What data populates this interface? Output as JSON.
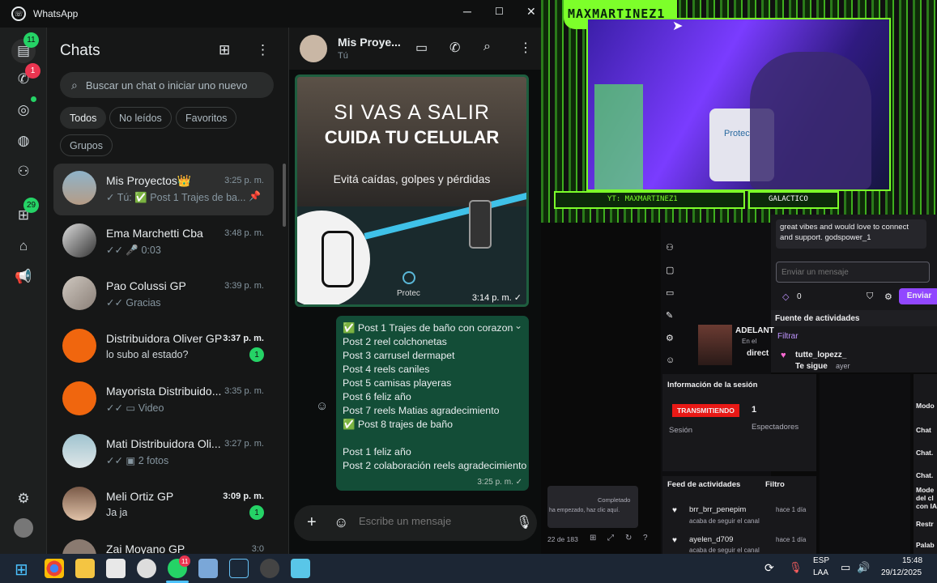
{
  "window": {
    "title": "WhatsApp",
    "minimize": "─",
    "maximize": "☐",
    "close": "✕"
  },
  "rail": {
    "chats_badge": "11",
    "calls_badge": "1",
    "archive_badge": "29"
  },
  "chatlist": {
    "title": "Chats",
    "search_placeholder": "Buscar un chat o iniciar uno nuevo",
    "filters": [
      "Todos",
      "No leídos",
      "Favoritos",
      "Grupos"
    ],
    "items": [
      {
        "name": "Mis Proyectos👑",
        "time": "3:25 p. m.",
        "preview": "✓ Tú: ✅ Post 1 Trajes de ba...",
        "pinned": true
      },
      {
        "name": "Ema Marchetti Cba",
        "time": "3:48 p. m.",
        "preview": "✓✓ 🎤 0:03"
      },
      {
        "name": "Pao Colussi GP",
        "time": "3:39 p. m.",
        "preview": "✓✓ Gracias"
      },
      {
        "name": "Distribuidora Oliver GP",
        "time": "3:37 p. m.",
        "preview": "lo subo al estado?",
        "unread": "1"
      },
      {
        "name": "Mayorista Distribuido...",
        "time": "3:35 p. m.",
        "preview": "✓✓ ▭ Video"
      },
      {
        "name": "Mati Distribuidora Oli...",
        "time": "3:27 p. m.",
        "preview": "✓✓ ▣ 2 fotos"
      },
      {
        "name": "Meli Ortiz GP",
        "time": "3:09 p. m.",
        "preview": "Ja ja",
        "unread": "1"
      },
      {
        "name": "Zai Moyano GP",
        "time": "3:0",
        "preview": ""
      }
    ]
  },
  "conversation": {
    "name": "Mis Proye...",
    "status": "Tú",
    "image_msg": {
      "line1": "SI VAS A SALIR",
      "line2": "CUIDA TU CELULAR",
      "line3": "Evitá caídas, golpes y pérdidas",
      "brand": "Protec",
      "time": "3:14 p. m. ✓"
    },
    "text_msg": {
      "lines": [
        "✅ Post 1 Trajes de baño con corazon",
        "Post 2 reel colchonetas",
        "Post 3 carrusel dermapet",
        "Post 4 reels caniles",
        "Post 5 camisas playeras",
        "Post 6 feliz año",
        "Post 7 reels Matias agradecimiento",
        "✅ Post 8 trajes de baño",
        "",
        "Post 1 feliz año",
        "Post 2 colaboración reels agradecimiento"
      ],
      "time": "3:25 p. m. ✓"
    },
    "composer_placeholder": "Escribe un mensaje"
  },
  "stream": {
    "overlay_name": "MAXMARTINEZ1",
    "yt_label": "YT: MAXMARTINEZ1",
    "badge_label": "GALACTICO",
    "camera_brand": "Protec",
    "chat_msg": "great vibes and would love to connect and support. godspower_1",
    "send_placeholder": "Enviar un mensaje",
    "points": "0",
    "send_button": "Enviar",
    "activity_title": "Fuente de actividades",
    "filter_label": "Filtrar",
    "activity_user": "tutte_lopezz_",
    "activity_action": "Te sigue",
    "activity_when": "ayer",
    "promo_title": "ADELANT",
    "promo_sub1": "En el",
    "promo_sub2": "direct",
    "session_title": "Información de la sesión",
    "live_label": "TRANSMITIENDO",
    "viewers": "1",
    "viewers_label": "Espectadores",
    "session_label": "Sesión",
    "feed_title": "Feed de actividades",
    "feed_filter": "Filtro",
    "feed": [
      {
        "user": "brr_brr_penepim",
        "when": "hace 1 día",
        "action": "acaba de seguir el canal"
      },
      {
        "user": "ayelen_d709",
        "when": "hace 1 día",
        "action": "acaba de seguir el canal"
      }
    ],
    "toast_status": "Completado",
    "toast_text": "ha empezado, haz clic aquí.",
    "pager": "22 de 183",
    "side_labels": [
      "Modo",
      "Chat",
      "Chat.",
      "Chat.",
      "Mode del cl con IA",
      "Restr",
      "Palab"
    ]
  },
  "taskbar": {
    "whatsapp_badge": "11",
    "lang1": "ESP",
    "lang2": "LAA",
    "time": "15:48",
    "date": "29/12/2025"
  }
}
